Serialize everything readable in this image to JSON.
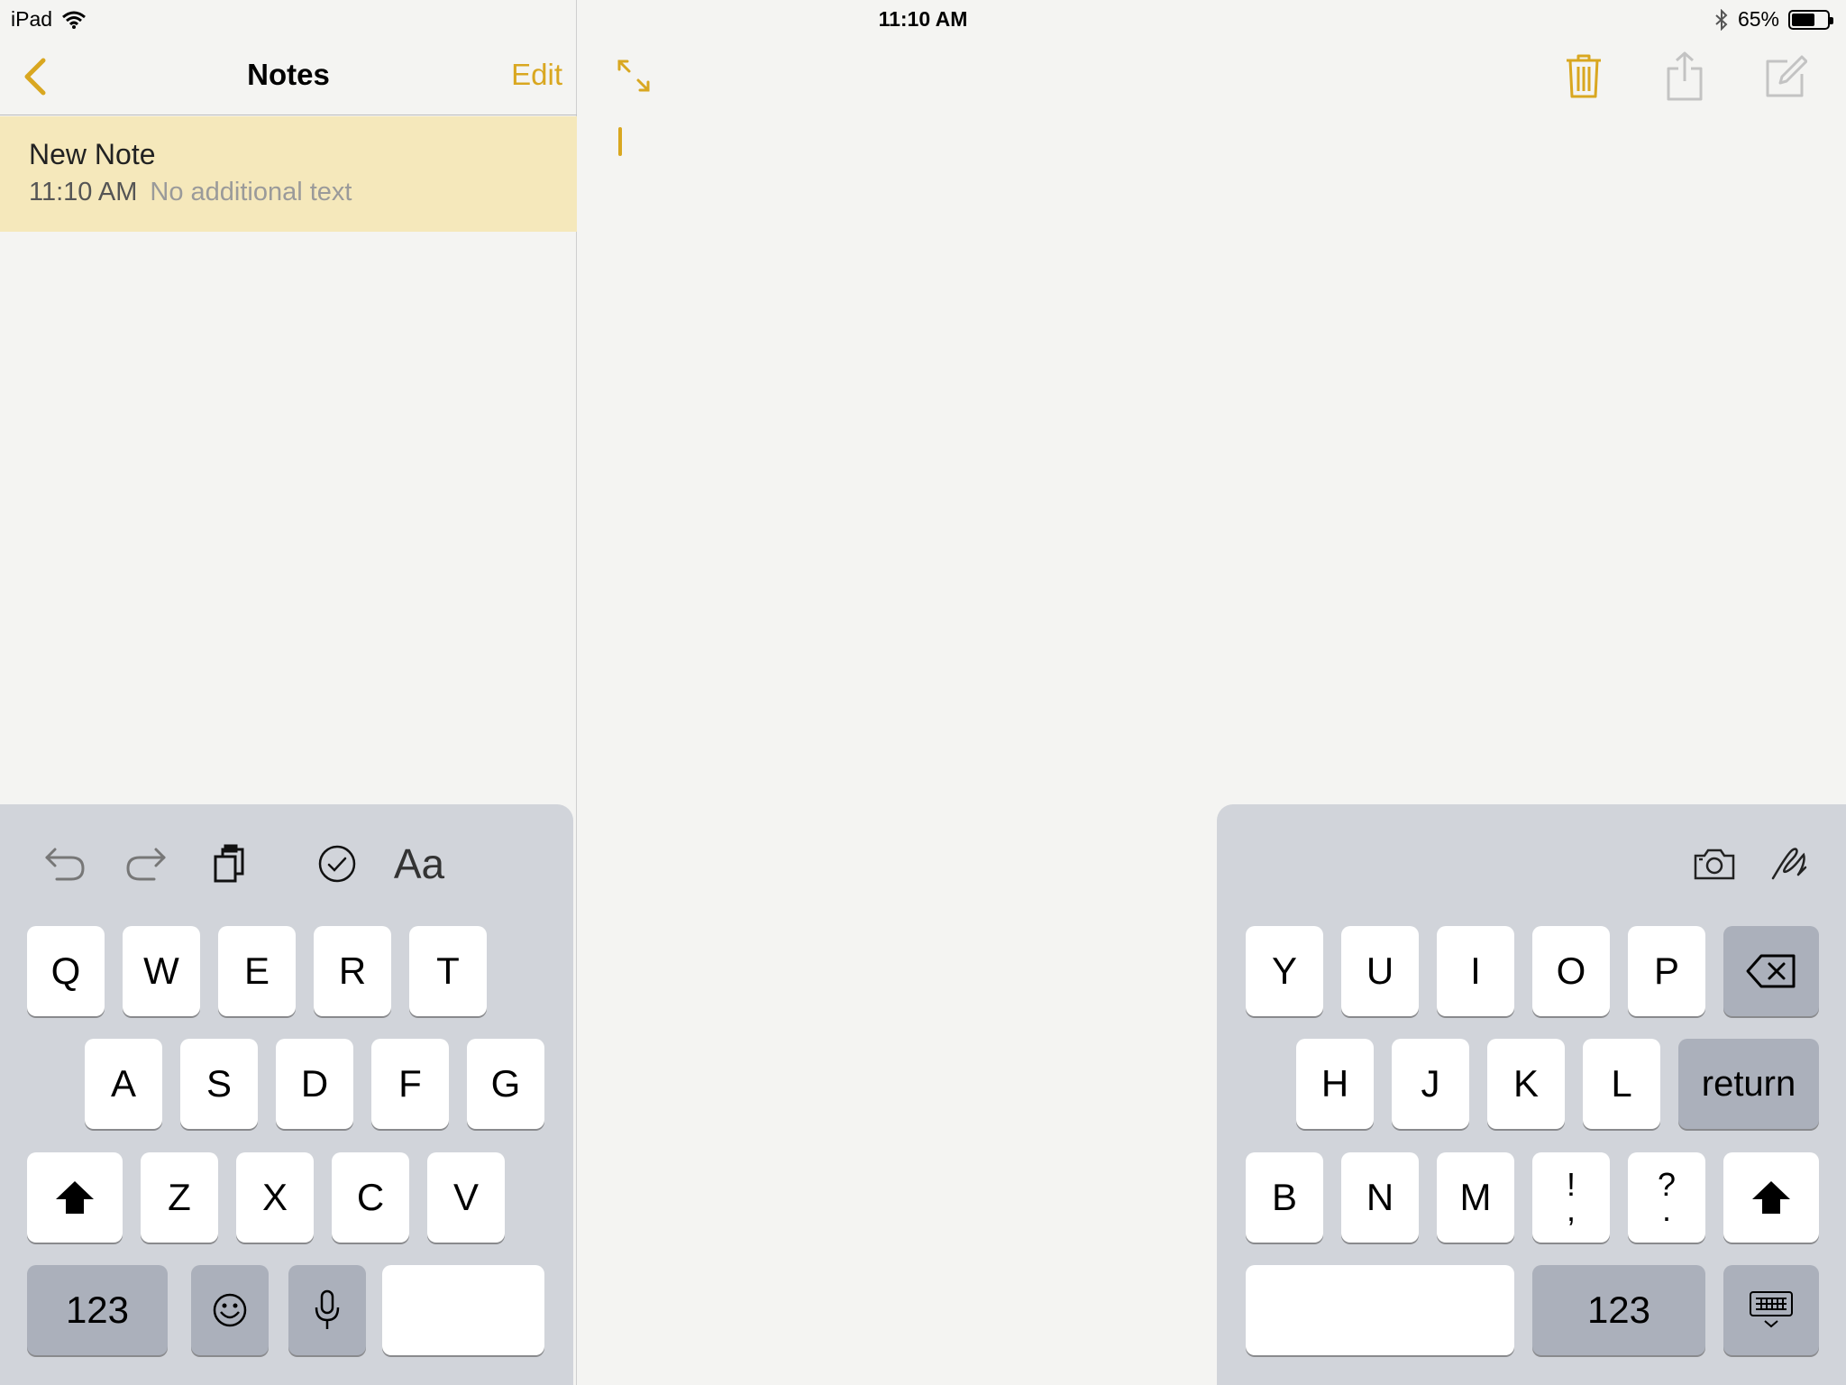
{
  "status_bar": {
    "device": "iPad",
    "time": "11:10 AM",
    "battery_percent": "65%",
    "battery_level": 0.65
  },
  "sidebar": {
    "title": "Notes",
    "edit_label": "Edit",
    "notes": [
      {
        "title": "New Note",
        "time": "11:10 AM",
        "preview": "No additional text"
      }
    ]
  },
  "colors": {
    "accent": "#d9a720",
    "selected_row": "#f5e8bb",
    "keyboard_bg": "#d1d4da",
    "dark_key": "#abb0bb"
  },
  "keyboard": {
    "left_shortcuts": [
      "undo-icon",
      "redo-icon",
      "paste-icon",
      "checklist-icon",
      "Aa"
    ],
    "right_shortcuts": [
      "camera-icon",
      "sketch-icon"
    ],
    "left": {
      "row1": [
        "Q",
        "W",
        "E",
        "R",
        "T"
      ],
      "row2": [
        "A",
        "S",
        "D",
        "F",
        "G"
      ],
      "row3": [
        "Z",
        "X",
        "C",
        "V"
      ],
      "num_label": "123"
    },
    "right": {
      "row1": [
        "Y",
        "U",
        "I",
        "O",
        "P"
      ],
      "row2": [
        "H",
        "J",
        "K",
        "L"
      ],
      "return_label": "return",
      "row3": [
        "B",
        "N",
        "M"
      ],
      "punct1": [
        "!",
        ","
      ],
      "punct2": [
        "?",
        "."
      ],
      "num_label": "123"
    }
  }
}
